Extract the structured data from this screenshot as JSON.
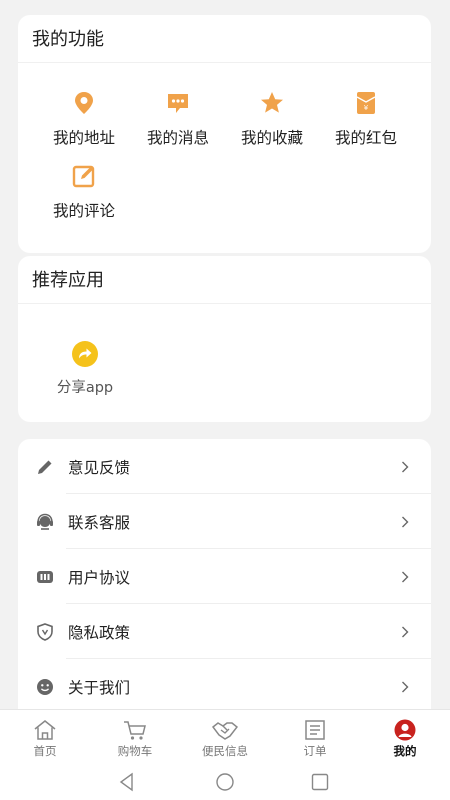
{
  "functions": {
    "title": "我的功能",
    "items": [
      {
        "label": "我的地址",
        "icon": "location-pin-icon"
      },
      {
        "label": "我的消息",
        "icon": "message-icon"
      },
      {
        "label": "我的收藏",
        "icon": "star-icon"
      },
      {
        "label": "我的红包",
        "icon": "red-envelope-icon"
      },
      {
        "label": "我的评论",
        "icon": "edit-comment-icon"
      }
    ]
  },
  "recommended": {
    "title": "推荐应用",
    "items": [
      {
        "label": "分享app",
        "icon": "share-icon"
      }
    ]
  },
  "menu": [
    {
      "label": "意见反馈",
      "icon": "pencil-icon"
    },
    {
      "label": "联系客服",
      "icon": "headset-icon"
    },
    {
      "label": "用户协议",
      "icon": "agreement-icon"
    },
    {
      "label": "隐私政策",
      "icon": "shield-icon"
    },
    {
      "label": "关于我们",
      "icon": "smiley-icon"
    }
  ],
  "tabbar": {
    "items": [
      {
        "label": "首页",
        "icon": "home-icon"
      },
      {
        "label": "购物车",
        "icon": "cart-icon"
      },
      {
        "label": "便民信息",
        "icon": "handshake-icon"
      },
      {
        "label": "订单",
        "icon": "order-list-icon"
      },
      {
        "label": "我的",
        "icon": "user-icon"
      }
    ],
    "active": "我的"
  },
  "colors": {
    "accent_orange": "#f0a24a",
    "share_yellow": "#f5c21b",
    "active_red": "#c8221e",
    "background": "#f2f2f2"
  }
}
